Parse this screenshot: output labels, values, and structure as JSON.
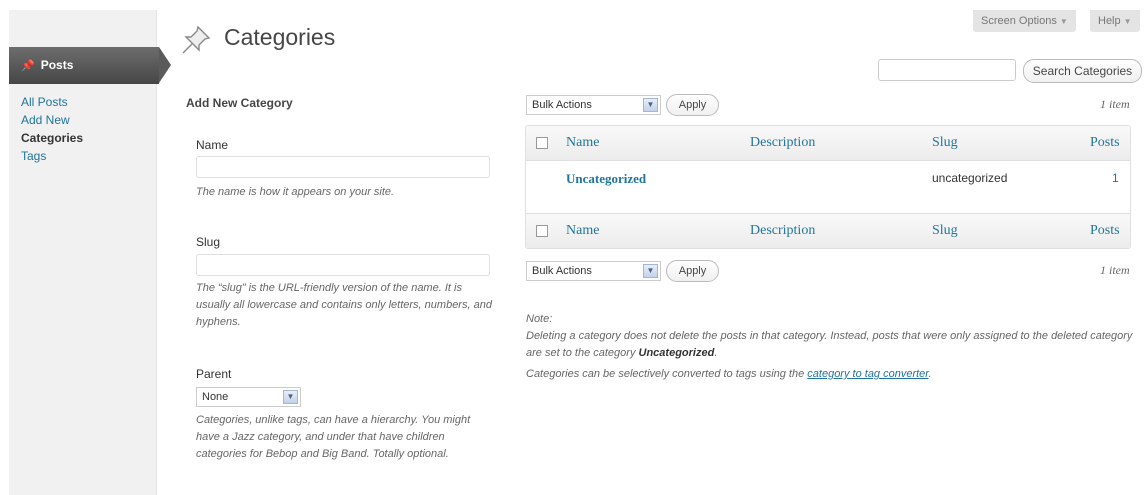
{
  "sidebar": {
    "posts_label": "Posts",
    "items": [
      {
        "label": "All Posts"
      },
      {
        "label": "Add New"
      },
      {
        "label": "Categories"
      },
      {
        "label": "Tags"
      }
    ]
  },
  "header": {
    "title": "Categories",
    "screen_options": "Screen Options",
    "help": "Help"
  },
  "search": {
    "button_label": "Search Categories",
    "value": ""
  },
  "form": {
    "heading": "Add New Category",
    "name_label": "Name",
    "name_value": "",
    "name_desc": "The name is how it appears on your site.",
    "slug_label": "Slug",
    "slug_value": "",
    "slug_desc": "The “slug” is the URL-friendly version of the name. It is usually all lowercase and contains only letters, numbers, and hyphens.",
    "parent_label": "Parent",
    "parent_value": "None",
    "parent_desc": "Categories, unlike tags, can have a hierarchy. You might have a Jazz category, and under that have children categories for Bebop and Big Band. Totally optional."
  },
  "bulk": {
    "top_select": "Bulk Actions",
    "top_apply": "Apply",
    "bottom_select": "Bulk Actions",
    "bottom_apply": "Apply",
    "item_count": "1 item"
  },
  "table": {
    "columns": [
      "Name",
      "Description",
      "Slug",
      "Posts"
    ],
    "rows": [
      {
        "name": "Uncategorized",
        "description": "",
        "slug": "uncategorized",
        "posts": "1"
      }
    ]
  },
  "note": {
    "label": "Note:",
    "text_prefix": "Deleting a category does not delete the posts in that category. Instead, posts that were only assigned to the deleted category are set to the category ",
    "text_bold": "Uncategorized",
    "text_suffix": ".",
    "convert_prefix": "Categories can be selectively converted to tags using the ",
    "convert_link": "category to tag converter",
    "convert_suffix": "."
  },
  "colors": {
    "link": "#21759b",
    "sidebar_active": "#464646"
  }
}
